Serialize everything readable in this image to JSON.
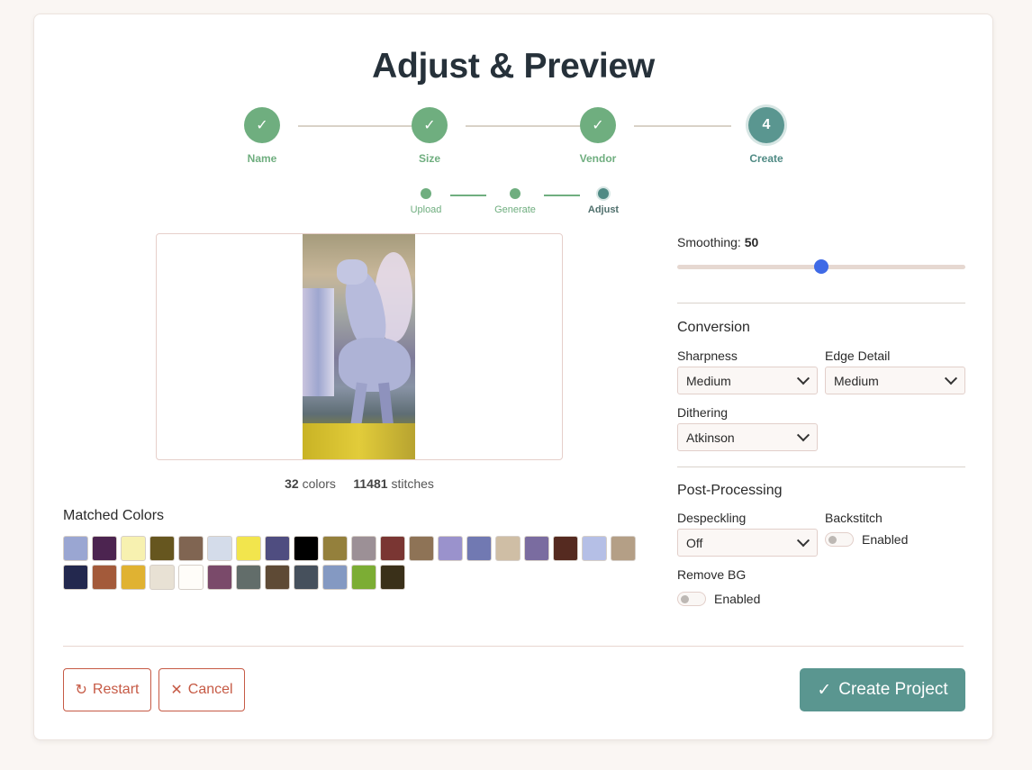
{
  "page": {
    "title": "Adjust & Preview"
  },
  "stepper": {
    "steps": [
      {
        "label": "Name",
        "status": "done"
      },
      {
        "label": "Size",
        "status": "done"
      },
      {
        "label": "Vendor",
        "status": "done"
      },
      {
        "label": "Create",
        "status": "current",
        "number": "4"
      }
    ],
    "substeps": [
      {
        "label": "Upload",
        "status": "done"
      },
      {
        "label": "Generate",
        "status": "done"
      },
      {
        "label": "Adjust",
        "status": "current"
      }
    ]
  },
  "preview": {
    "colors_count": "32",
    "colors_label": "colors",
    "stitches_count": "11481",
    "stitches_label": "stitches"
  },
  "matched": {
    "title": "Matched Colors",
    "swatches": [
      "#9aa6d2",
      "#4c2450",
      "#f7f1b0",
      "#66561f",
      "#806552",
      "#d4dcea",
      "#f2e54d",
      "#4f4d80",
      "#000000",
      "#94803c",
      "#9c9096",
      "#7a3633",
      "#8e7356",
      "#9a92cc",
      "#7179b2",
      "#cfbea5",
      "#7a6ca0",
      "#552a20",
      "#b5bfe6",
      "#b49f86",
      "#23284e",
      "#a35a3a",
      "#e0b232",
      "#e8e1d4",
      "#fffdf9",
      "#7a4a6a",
      "#626d6a",
      "#5e4a35",
      "#46505c",
      "#8499c2",
      "#7cad34",
      "#3a3019"
    ]
  },
  "settings": {
    "smoothing_label": "Smoothing:",
    "smoothing_value": "50",
    "smoothing_fraction": 0.5,
    "conversion": {
      "title": "Conversion",
      "sharpness_label": "Sharpness",
      "sharpness_value": "Medium",
      "edge_label": "Edge Detail",
      "edge_value": "Medium",
      "dithering_label": "Dithering",
      "dithering_value": "Atkinson"
    },
    "post": {
      "title": "Post-Processing",
      "despeckling_label": "Despeckling",
      "despeckling_value": "Off",
      "backstitch_label": "Backstitch",
      "backstitch_toggle": "Enabled",
      "remove_bg_label": "Remove BG",
      "remove_bg_toggle": "Enabled"
    }
  },
  "footer": {
    "restart_label": "Restart",
    "cancel_label": "Cancel",
    "create_label": "Create Project"
  },
  "colors": {
    "accent": "#5a9690",
    "done": "#6fae7f",
    "danger": "#c65a45",
    "slider": "#3f6ae6"
  }
}
